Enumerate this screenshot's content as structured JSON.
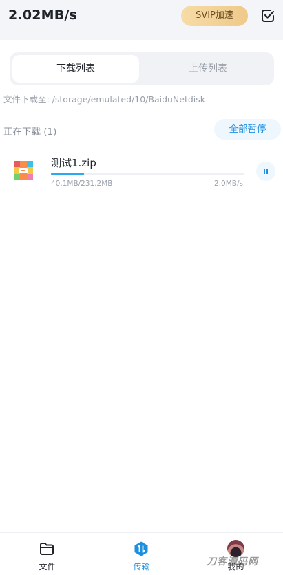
{
  "header": {
    "speed": "2.02MB/s",
    "svip_label": "SVIP加速",
    "check_icon": "checkbox-icon"
  },
  "tabs": {
    "download": "下载列表",
    "upload": "上传列表"
  },
  "download_path": "文件下载至: /storage/emulated/10/BaiduNetdisk",
  "section": {
    "title": "正在下载 (1)",
    "pause_all": "全部暂停"
  },
  "downloads": [
    {
      "name": "测试1.zip",
      "progress_text": "40.1MB/231.2MB",
      "speed": "2.0MB/s",
      "progress": 0.173,
      "icon": "zip-archive-icon",
      "action_icon": "pause-icon"
    }
  ],
  "nav": {
    "items": [
      {
        "label": "文件",
        "icon": "folder-icon",
        "active": false
      },
      {
        "label": "传输",
        "icon": "transfer-icon",
        "active": true
      },
      {
        "label": "我的",
        "icon": "avatar",
        "active": false
      }
    ]
  },
  "watermark": "刀客源码网",
  "colors": {
    "accent": "#1e8fe0",
    "svip_gold": "#eec98a",
    "header_bg": "#f4f5f9"
  }
}
